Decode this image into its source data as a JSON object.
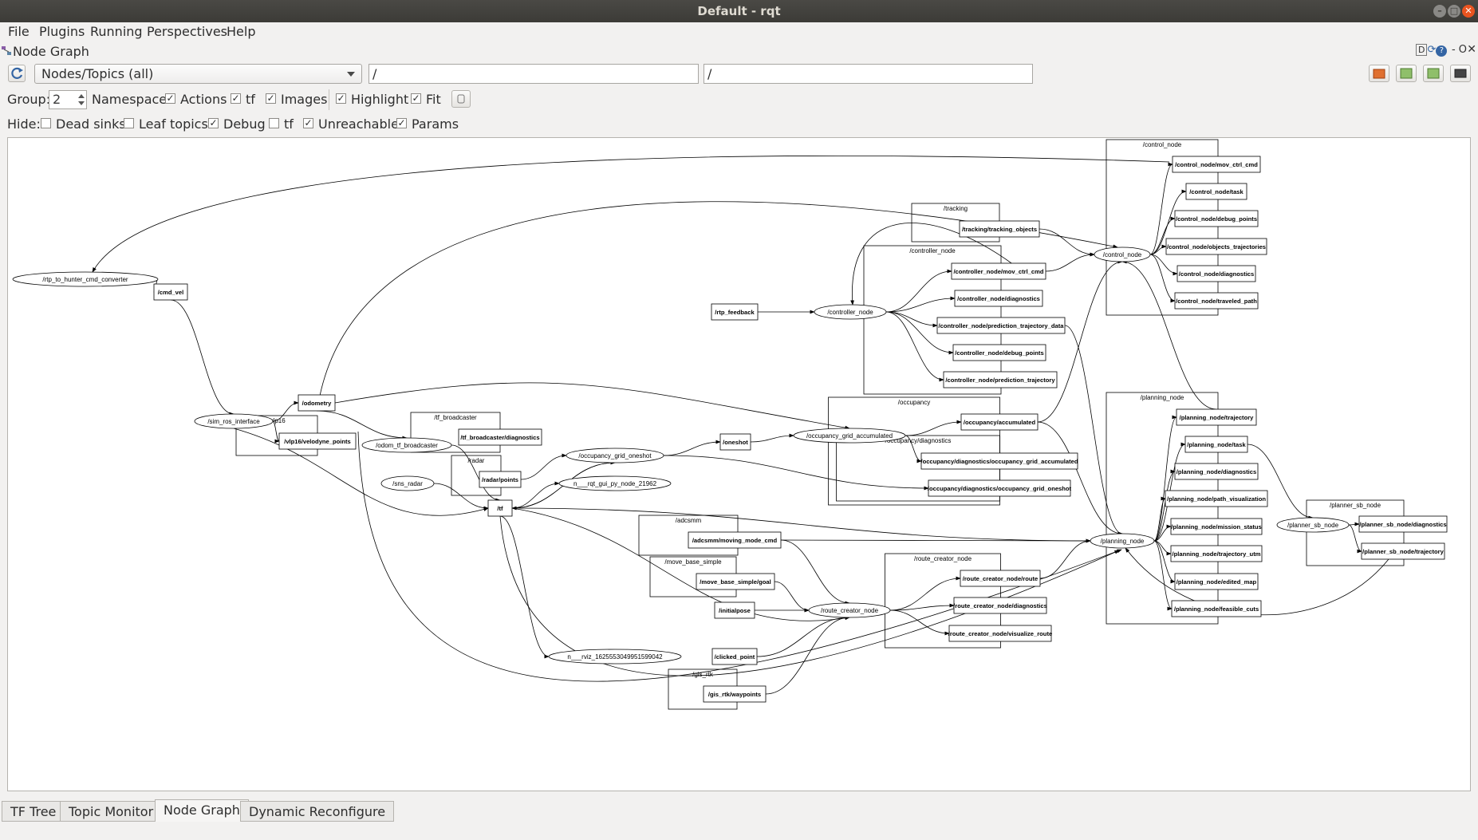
{
  "window": {
    "title": "Default - rqt"
  },
  "menu": [
    "File",
    "Plugins",
    "Running",
    "Perspectives",
    "Help"
  ],
  "plugin": {
    "title": "Node Graph",
    "controls": "DC? - O X"
  },
  "toolbar": {
    "mode": "Nodes/Topics (all)",
    "ns_filter": "/",
    "topic_filter": "/"
  },
  "row1": {
    "group_label": "Group:",
    "group_value": "2",
    "namespaces": "Namespaces",
    "actions": "Actions",
    "tf": "tf",
    "images": "Images",
    "highlight": "Highlight",
    "fit": "Fit"
  },
  "row2": {
    "hide_label": "Hide:",
    "dead_sinks": "Dead sinks",
    "leaf_topics": "Leaf topics",
    "debug": "Debug",
    "tf": "tf",
    "unreachable": "Unreachable",
    "params": "Params"
  },
  "graph": {
    "clusters": [
      {
        "id": "control",
        "label": "/control_node"
      },
      {
        "id": "tracking",
        "label": "/tracking"
      },
      {
        "id": "controller",
        "label": "/controller_node"
      },
      {
        "id": "occupancy",
        "label": "/occupancy"
      },
      {
        "id": "occdiag",
        "label": "/occupancy/diagnostics"
      },
      {
        "id": "planning",
        "label": "/planning_node"
      },
      {
        "id": "plannersb",
        "label": "/planner_sb_node"
      },
      {
        "id": "vlp16",
        "label": "/vlp16"
      },
      {
        "id": "tfb",
        "label": "/tf_broadcaster"
      },
      {
        "id": "radar",
        "label": "/radar"
      },
      {
        "id": "adcsmm",
        "label": "/adcsmm"
      },
      {
        "id": "mbs",
        "label": "/move_base_simple"
      },
      {
        "id": "route",
        "label": "/route_creator_node"
      },
      {
        "id": "gisrtk",
        "label": "/gis_rtk"
      }
    ],
    "nodes": [
      {
        "id": "rtp2h",
        "label": "/rtp_to_hunter_cmd_converter"
      },
      {
        "id": "sim",
        "label": "/sim_ros_interface"
      },
      {
        "id": "odomtf",
        "label": "/odom_tf_broadcaster"
      },
      {
        "id": "sns",
        "label": "/sns_radar"
      },
      {
        "id": "oneshotn",
        "label": "/occupancy_grid_oneshot"
      },
      {
        "id": "rqtgui",
        "label": "n___rqt_gui_py_node_21962"
      },
      {
        "id": "accn",
        "label": "/occupancy_grid_accumulated"
      },
      {
        "id": "controllern",
        "label": "/controller_node"
      },
      {
        "id": "controln",
        "label": "/control_node"
      },
      {
        "id": "planningn",
        "label": "/planning_node"
      },
      {
        "id": "routen",
        "label": "/route_creator_node"
      },
      {
        "id": "rviz",
        "label": "n___rviz_1625553049951599042"
      },
      {
        "id": "plannersbn",
        "label": "/planner_sb_node"
      }
    ],
    "topics": [
      {
        "id": "cmdvel",
        "label": "/cmd_vel"
      },
      {
        "id": "odom",
        "label": "/odometry"
      },
      {
        "id": "vlppts",
        "label": "/vlp16/velodyne_points"
      },
      {
        "id": "tfbdiag",
        "label": "/tf_broadcaster/diagnostics"
      },
      {
        "id": "radarpts",
        "label": "/radar/points"
      },
      {
        "id": "tf",
        "label": "/tf"
      },
      {
        "id": "oneshot",
        "label": "/oneshot"
      },
      {
        "id": "rtpfb",
        "label": "/rtp_feedback"
      },
      {
        "id": "trk",
        "label": "/tracking/tracking_objects"
      },
      {
        "id": "cn_mov",
        "label": "/controller_node/mov_ctrl_cmd"
      },
      {
        "id": "cn_diag",
        "label": "/controller_node/diagnostics"
      },
      {
        "id": "cn_pred",
        "label": "/controller_node/prediction_trajectory_data"
      },
      {
        "id": "cn_dbg",
        "label": "/controller_node/debug_points"
      },
      {
        "id": "cn_ptraj",
        "label": "/controller_node/prediction_trajectory"
      },
      {
        "id": "occacc",
        "label": "/occupancy/accumulated"
      },
      {
        "id": "od_acc",
        "label": "/occupancy/diagnostics/occupancy_grid_accumulated"
      },
      {
        "id": "od_one",
        "label": "/occupancy/diagnostics/occupancy_grid_oneshot"
      },
      {
        "id": "ctl_mov",
        "label": "/control_node/mov_ctrl_cmd"
      },
      {
        "id": "ctl_task",
        "label": "/control_node/task"
      },
      {
        "id": "ctl_dbg",
        "label": "/control_node/debug_points"
      },
      {
        "id": "ctl_obj",
        "label": "/control_node/objects_trajectories"
      },
      {
        "id": "ctl_diag",
        "label": "/control_node/diagnostics"
      },
      {
        "id": "ctl_path",
        "label": "/control_node/traveled_path"
      },
      {
        "id": "pl_traj",
        "label": "/planning_node/trajectory"
      },
      {
        "id": "pl_task",
        "label": "/planning_node/task"
      },
      {
        "id": "pl_diag",
        "label": "/planning_node/diagnostics"
      },
      {
        "id": "pl_vis",
        "label": "/planning_node/path_visualization"
      },
      {
        "id": "pl_ms",
        "label": "/planning_node/mission_status"
      },
      {
        "id": "pl_utm",
        "label": "/planning_node/trajectory_utm"
      },
      {
        "id": "pl_map",
        "label": "/planning_node/edited_map"
      },
      {
        "id": "pl_cuts",
        "label": "/planning_node/feasible_cuts"
      },
      {
        "id": "psb_diag",
        "label": "/planner_sb_node/diagnostics"
      },
      {
        "id": "psb_traj",
        "label": "/planner_sb_node/trajectory"
      },
      {
        "id": "adc_mov",
        "label": "/adcsmm/moving_mode_cmd"
      },
      {
        "id": "mbs_goal",
        "label": "/move_base_simple/goal"
      },
      {
        "id": "initpose",
        "label": "/initialpose"
      },
      {
        "id": "clicked",
        "label": "/clicked_point"
      },
      {
        "id": "gis_wp",
        "label": "/gis_rtk/waypoints"
      },
      {
        "id": "rc_route",
        "label": "/route_creator_node/route"
      },
      {
        "id": "rc_diag",
        "label": "/route_creator_node/diagnostics"
      },
      {
        "id": "rc_vis",
        "label": "/route_creator_node/visualize_route"
      }
    ]
  },
  "tabs": [
    "TF Tree",
    "Topic Monitor",
    "Node Graph",
    "Dynamic Reconfigure"
  ],
  "colors": {
    "titlebar": "#3c3b37",
    "close": "#e95420",
    "canvas": "#ffffff"
  }
}
